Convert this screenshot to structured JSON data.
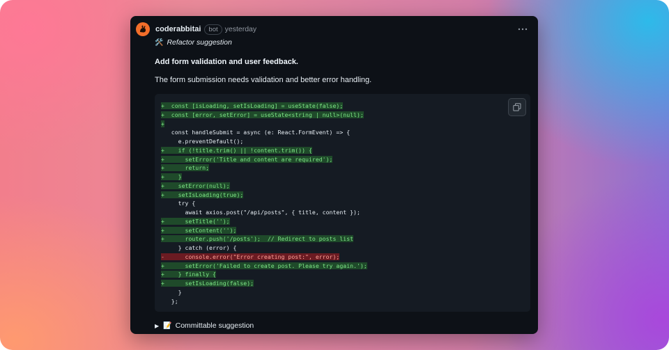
{
  "comment": {
    "author": "coderabbitai",
    "badge": "bot",
    "time": "yesterday",
    "label": "Refactor suggestion",
    "title": "Add form validation and user feedback.",
    "description": "The form submission needs validation and better error handling.",
    "footer": "Committable suggestion"
  },
  "code_lines": [
    {
      "t": "add",
      "p": "+",
      "c": "  const [isLoading, setIsLoading] = useState(false);"
    },
    {
      "t": "add",
      "p": "+",
      "c": "  const [error, setError] = useState<string | null>(null);"
    },
    {
      "t": "add",
      "p": "+",
      "c": ""
    },
    {
      "t": "ctx",
      "p": " ",
      "c": "  const handleSubmit = async (e: React.FormEvent) => {"
    },
    {
      "t": "ctx",
      "p": " ",
      "c": "    e.preventDefault();"
    },
    {
      "t": "add",
      "p": "+",
      "c": "    if (!title.trim() || !content.trim()) {"
    },
    {
      "t": "add",
      "p": "+",
      "c": "      setError('Title and content are required');"
    },
    {
      "t": "add",
      "p": "+",
      "c": "      return;"
    },
    {
      "t": "add",
      "p": "+",
      "c": "    }"
    },
    {
      "t": "add",
      "p": "+",
      "c": "    setError(null);"
    },
    {
      "t": "add",
      "p": "+",
      "c": "    setIsLoading(true);"
    },
    {
      "t": "ctx",
      "p": " ",
      "c": "    try {"
    },
    {
      "t": "ctx",
      "p": " ",
      "c": "      await axios.post(\"/api/posts\", { title, content });"
    },
    {
      "t": "add",
      "p": "+",
      "c": "      setTitle('');"
    },
    {
      "t": "add",
      "p": "+",
      "c": "      setContent('');"
    },
    {
      "t": "add",
      "p": "+",
      "c": "      router.push('/posts');  // Redirect to posts list"
    },
    {
      "t": "ctx",
      "p": " ",
      "c": "    } catch (error) {"
    },
    {
      "t": "del",
      "p": "-",
      "c": "      console.error(\"Error creating post:\", error);"
    },
    {
      "t": "add",
      "p": "+",
      "c": "      setError('Failed to create post. Please try again.');"
    },
    {
      "t": "add",
      "p": "+",
      "c": "    } finally {"
    },
    {
      "t": "add",
      "p": "+",
      "c": "      setIsLoading(false);"
    },
    {
      "t": "ctx",
      "p": " ",
      "c": "    }"
    },
    {
      "t": "ctx",
      "p": " ",
      "c": "  };"
    }
  ],
  "icons": {
    "avatar": "rabbit-logo-icon",
    "menu": "kebab-menu-icon",
    "refactor": "tools-icon",
    "copy": "copy-icon",
    "expand": "triangle-right-icon",
    "memo": "memo-icon"
  },
  "colors": {
    "card_bg": "#0d1117",
    "code_bg": "#151b23",
    "add_bg": "#1f4a2a",
    "add_fg": "#7ee787",
    "del_bg": "#6b1b22",
    "del_fg": "#ffa198",
    "avatar": "#f36e2a"
  }
}
